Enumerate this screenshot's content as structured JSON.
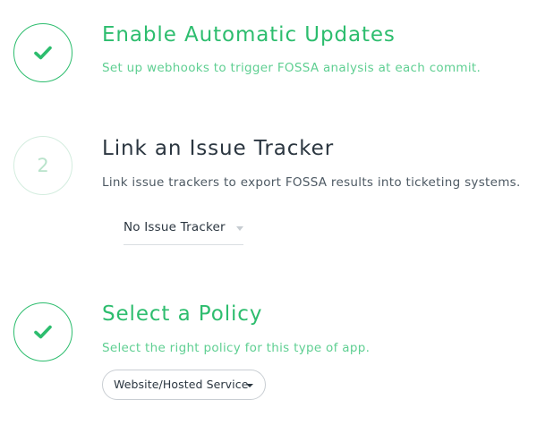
{
  "steps": [
    {
      "status": "done",
      "icon": "check-icon",
      "title": "Enable Automatic Updates",
      "description": "Set up webhooks to trigger FOSSA analysis at each commit."
    },
    {
      "status": "todo",
      "number": "2",
      "title": "Link an Issue Tracker",
      "description": "Link issue trackers to export FOSSA results into ticketing systems.",
      "control": {
        "type": "select",
        "selected": "No Issue Tracker",
        "icon": "caret-down-icon"
      }
    },
    {
      "status": "done",
      "icon": "check-icon",
      "title": "Select a Policy",
      "description": "Select the right policy for this type of app.",
      "control": {
        "type": "dropdown-button",
        "selected": "Website/Hosted Service",
        "icon": "caret-down-icon"
      }
    }
  ],
  "colors": {
    "accent_green": "#2dbd6e",
    "light_green_text": "#5fcf92",
    "pending_circle": "#d4eddf",
    "dark_text": "#2b3640",
    "muted_text": "#4d5963"
  }
}
